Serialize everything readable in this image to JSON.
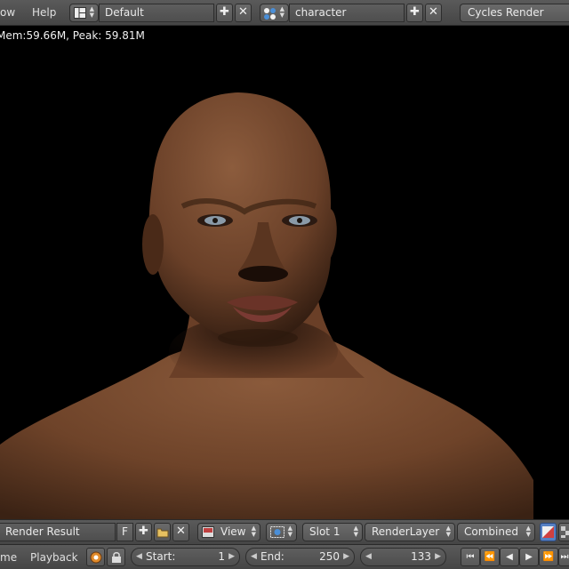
{
  "top_header": {
    "menu_window": "ow",
    "menu_help": "Help",
    "screen_layout": "Default",
    "scene": "character",
    "render_engine": "Cycles Render"
  },
  "viewport": {
    "memory_info": "Mem:59.66M, Peak: 59.81M"
  },
  "image_editor_header": {
    "image_name": "Render Result",
    "fake_user": "F",
    "view_menu": "View",
    "slot": "Slot 1",
    "render_layer": "RenderLayer",
    "pass": "Combined"
  },
  "timeline_header": {
    "menu_frame": "me",
    "menu_playback": "Playback",
    "start_label": "Start:",
    "start_value": "1",
    "end_label": "End:",
    "end_value": "250",
    "current_frame": "133"
  },
  "colors": {
    "header_bg": "#4b4b4b",
    "widget_bg": "#606060",
    "viewport_bg": "#000000",
    "skin": "#7a4a30"
  }
}
